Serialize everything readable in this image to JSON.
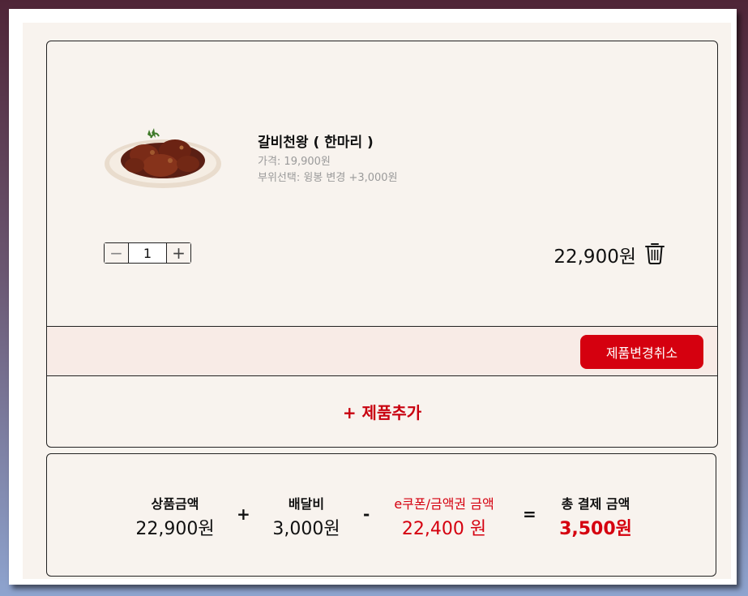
{
  "product": {
    "name": "갈비천왕 ( 한마리 )",
    "price": "가격: 19,900원",
    "option": "부위선택: 윙봉 변경 +3,000원",
    "quantity": "1",
    "line_total": "22,900원",
    "qty_minus": "−",
    "qty_plus": "+"
  },
  "actions": {
    "cancel_change": "제품변경취소",
    "add_product": "+ 제품추가"
  },
  "summary": {
    "product_label": "상품금액",
    "product_value": "22,900원",
    "op_plus": "+",
    "delivery_label": "배달비",
    "delivery_value": "3,000원",
    "op_minus": "-",
    "coupon_label": "e쿠폰/금액권 금액",
    "coupon_value": "22,400 원",
    "op_equals": "=",
    "total_label": "총 결제 금액",
    "total_value": "3,500원"
  },
  "colors": {
    "accent": "#d5000f",
    "background": "#f8f3ee"
  },
  "icons": [
    "trash-icon",
    "chicken-dish-image"
  ]
}
